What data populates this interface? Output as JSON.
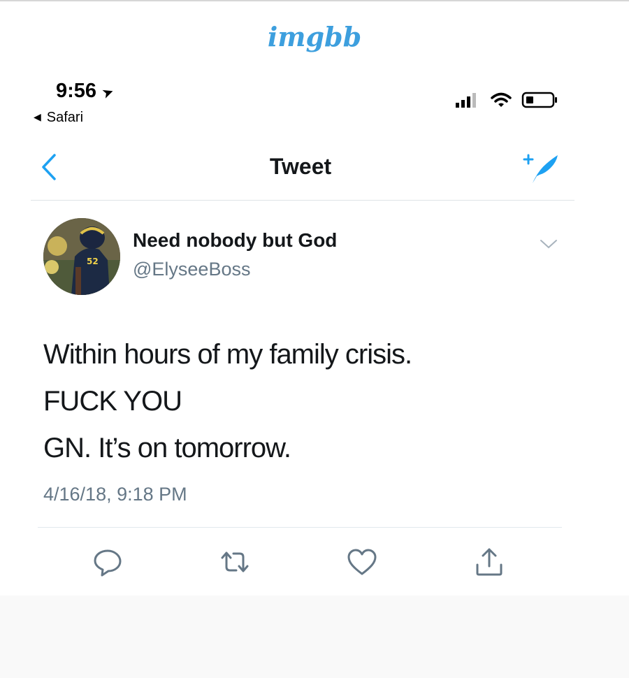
{
  "watermark": "imgbb",
  "status_bar": {
    "time": "9:56",
    "back_app": "Safari"
  },
  "nav": {
    "title": "Tweet"
  },
  "author": {
    "name": "Need nobody but God",
    "handle": "@ElyseeBoss"
  },
  "tweet": {
    "lines": [
      "Within hours of my family crisis.",
      "FUCK YOU",
      "GN. It’s on tomorrow."
    ],
    "timestamp": "4/16/18, 9:18 PM"
  },
  "colors": {
    "accent": "#1da1f2",
    "secondary_text": "#657786",
    "icon_gray": "#657786"
  },
  "icons": {
    "location": "location-arrow-icon",
    "back": "chevron-left-icon",
    "compose": "compose-tweet-icon",
    "menu": "chevron-down-icon",
    "reply": "reply-icon",
    "retweet": "retweet-icon",
    "like": "heart-icon",
    "share": "share-icon"
  }
}
